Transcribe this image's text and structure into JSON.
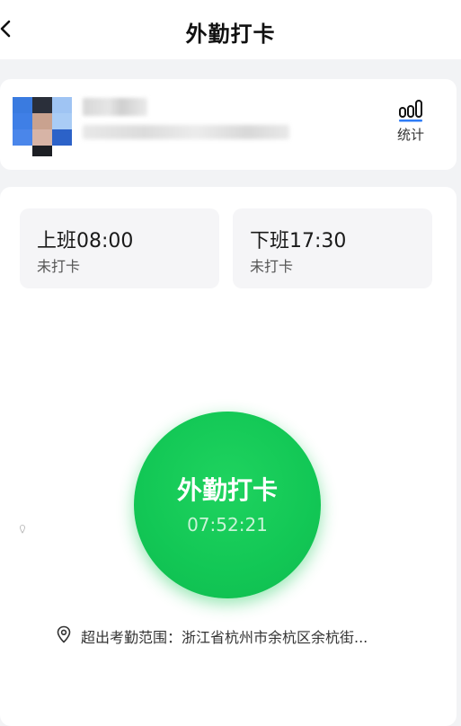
{
  "header": {
    "title": "外勤打卡"
  },
  "user": {
    "stats_label": "统计"
  },
  "shifts": [
    {
      "time": "上班08:00",
      "status": "未打卡"
    },
    {
      "time": "下班17:30",
      "status": "未打卡"
    }
  ],
  "clock_in": {
    "label": "外勤打卡",
    "time": "07:52:21"
  },
  "location": {
    "text": "超出考勤范围：浙江省杭州市余杭区余杭街..."
  },
  "colors": {
    "accent_green": "#12c755",
    "stats_blue": "#2f7cf6"
  }
}
